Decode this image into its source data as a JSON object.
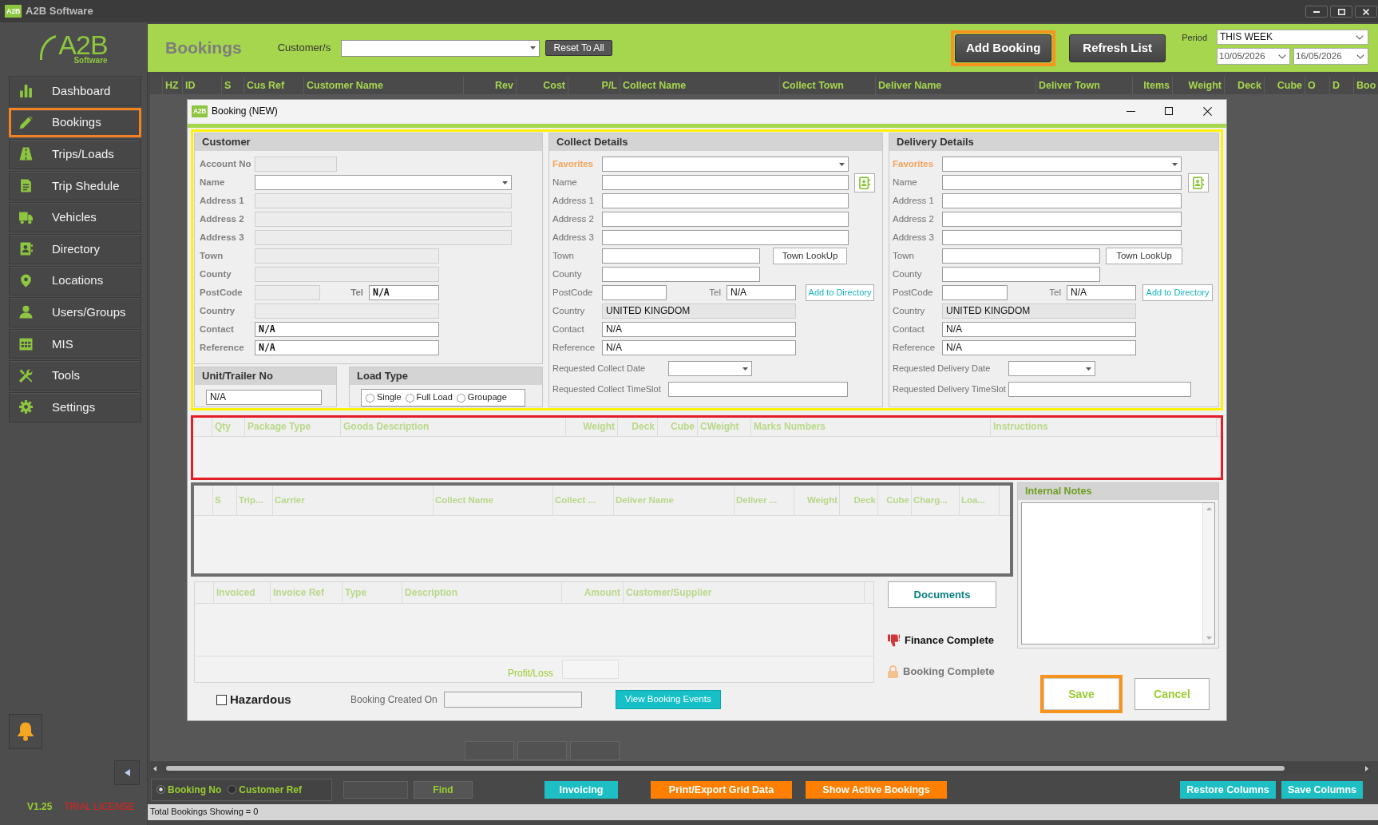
{
  "window": {
    "icon_text": "A2B",
    "title": "A2B Software"
  },
  "sidebar": {
    "logo": {
      "text": "A2B",
      "subtext": "Software"
    },
    "items": [
      {
        "label": "Dashboard",
        "selected": false
      },
      {
        "label": "Bookings",
        "selected": true
      },
      {
        "label": "Trips/Loads",
        "selected": false
      },
      {
        "label": "Trip Shedule",
        "selected": false
      },
      {
        "label": "Vehicles",
        "selected": false
      },
      {
        "label": "Directory",
        "selected": false
      },
      {
        "label": "Locations",
        "selected": false
      },
      {
        "label": "Users/Groups",
        "selected": false
      },
      {
        "label": "MIS",
        "selected": false
      },
      {
        "label": "Tools",
        "selected": false
      },
      {
        "label": "Settings",
        "selected": false
      }
    ],
    "version": "V1.25",
    "license": "TRIAL LICENSE"
  },
  "header": {
    "title": "Bookings",
    "customer_label": "Customer/s",
    "reset_button": "Reset To All",
    "add_button": {
      "label": "Add Booking",
      "highlighted": true
    },
    "refresh_button": "Refresh List",
    "period_label": "Period",
    "period": "THIS WEEK",
    "date_from": "10/05/2026",
    "date_to": "16/05/2026"
  },
  "grid": {
    "columns": [
      "HZ",
      "ID",
      "S",
      "Cus Ref",
      "Customer Name",
      "Rev",
      "Cost",
      "P/L",
      "Collect Name",
      "Collect Town",
      "Deliver Name",
      "Deliver Town",
      "Items",
      "Weight",
      "Deck",
      "Cube",
      "O",
      "D",
      "Boo"
    ]
  },
  "dialog": {
    "icon_text": "A2B",
    "title": "Booking (NEW)",
    "details_highlighted": true,
    "customer": {
      "title": "Customer",
      "rows": [
        {
          "label": "Account No",
          "kind": "text",
          "disabled": true
        },
        {
          "label": "Name",
          "kind": "dropdown",
          "disabled": false
        },
        {
          "label": "Address 1",
          "kind": "text",
          "disabled": true
        },
        {
          "label": "Address 2",
          "kind": "text",
          "disabled": true
        },
        {
          "label": "Address 3",
          "kind": "text",
          "disabled": true
        },
        {
          "label": "Town",
          "kind": "text",
          "disabled": true
        },
        {
          "label": "County",
          "kind": "text",
          "disabled": true
        },
        {
          "label": "PostCode",
          "kind": "text",
          "disabled": true,
          "tel": {
            "label": "Tel",
            "value": "N/A"
          }
        },
        {
          "label": "Country",
          "kind": "text",
          "disabled": true
        },
        {
          "label": "Contact",
          "kind": "text",
          "disabled": false,
          "value": "N/A"
        },
        {
          "label": "Reference",
          "kind": "text",
          "disabled": false,
          "value": "N/A"
        }
      ]
    },
    "unit": {
      "title": "Unit/Trailer No",
      "value": "N/A"
    },
    "load_type": {
      "title": "Load Type",
      "options": [
        {
          "label": "Single",
          "selected": false
        },
        {
          "label": "Full Load",
          "selected": false
        },
        {
          "label": "Groupage",
          "selected": false
        }
      ]
    },
    "collect": {
      "title": "Collect Details",
      "rows": [
        {
          "label": "Favorites",
          "kind": "favorites",
          "disabled": false
        },
        {
          "label": "Name",
          "kind": "text",
          "disabled": false,
          "contact_button": true
        },
        {
          "label": "Address 1",
          "kind": "text",
          "disabled": false
        },
        {
          "label": "Address 2",
          "kind": "text",
          "disabled": false
        },
        {
          "label": "Address 3",
          "kind": "text",
          "disabled": false
        },
        {
          "label": "Town",
          "kind": "text",
          "disabled": false,
          "button": {
            "label": "Town LookUp",
            "kind": "lookup"
          }
        },
        {
          "label": "County",
          "kind": "text",
          "disabled": false
        },
        {
          "label": "PostCode",
          "kind": "text",
          "disabled": false,
          "tel": {
            "label": "Tel",
            "value": "N/A"
          },
          "button": {
            "label": "Add to Directory",
            "kind": "directory"
          }
        },
        {
          "label": "Country",
          "kind": "text",
          "disabled": true,
          "value": "UNITED KINGDOM"
        },
        {
          "label": "Contact",
          "kind": "text",
          "disabled": false,
          "value": "N/A"
        },
        {
          "label": "Reference",
          "kind": "text",
          "disabled": false,
          "value": "N/A"
        }
      ],
      "schedule": [
        {
          "label": "Requested Collect Date",
          "kind": "dropdown"
        },
        {
          "label": "Requested Collect TimeSlot",
          "kind": "text"
        }
      ]
    },
    "delivery": {
      "title": "Delivery Details",
      "rows": [
        {
          "label": "Favorites",
          "kind": "favorites",
          "disabled": false
        },
        {
          "label": "Name",
          "kind": "text",
          "disabled": false,
          "contact_button": true
        },
        {
          "label": "Address 1",
          "kind": "text",
          "disabled": false
        },
        {
          "label": "Address 2",
          "kind": "text",
          "disabled": false
        },
        {
          "label": "Address 3",
          "kind": "text",
          "disabled": false
        },
        {
          "label": "Town",
          "kind": "text",
          "disabled": false,
          "button": {
            "label": "Town LookUp",
            "kind": "lookup"
          }
        },
        {
          "label": "County",
          "kind": "text",
          "disabled": false
        },
        {
          "label": "PostCode",
          "kind": "text",
          "disabled": false,
          "tel": {
            "label": "Tel",
            "value": "N/A"
          },
          "button": {
            "label": "Add to Directory",
            "kind": "directory"
          }
        },
        {
          "label": "Country",
          "kind": "text",
          "disabled": true,
          "value": "UNITED KINGDOM"
        },
        {
          "label": "Contact",
          "kind": "text",
          "disabled": false,
          "value": "N/A"
        },
        {
          "label": "Reference",
          "kind": "text",
          "disabled": false,
          "value": "N/A"
        }
      ],
      "schedule": [
        {
          "label": "Requested Delivery Date",
          "kind": "dropdown"
        },
        {
          "label": "Requested Delivery TimeSlot",
          "kind": "text"
        }
      ]
    },
    "goods_grid": {
      "highlighted": true,
      "columns": [
        "Qty",
        "Package Type",
        "Goods Description",
        "Weight",
        "Deck",
        "Cube",
        "CWeight",
        "Marks Numbers",
        "Instructions"
      ]
    },
    "trips_grid": {
      "highlighted": true,
      "columns": [
        "S",
        "Trip...",
        "Carrier",
        "Collect Name",
        "Collect ...",
        "Deliver Name",
        "Deliver ...",
        "Weight",
        "Deck",
        "Cube",
        "Charg...",
        "Loa..."
      ]
    },
    "internal_notes": {
      "title": "Internal Notes"
    },
    "invoice_grid": {
      "columns": [
        "Invoiced",
        "Invoice Ref",
        "Type",
        "Description",
        "Amount",
        "Customer/Supplier"
      ],
      "profit_label": "Profit/Loss"
    },
    "documents_button": "Documents",
    "statuses": [
      {
        "kind": "finance",
        "label": "Finance Complete"
      },
      {
        "kind": "booking",
        "label": "Booking Complete"
      }
    ],
    "hazardous": {
      "label": "Hazardous",
      "checked": false
    },
    "created_label": "Booking Created On",
    "events_button": "View Booking Events",
    "save_button": {
      "label": "Save",
      "highlighted": true
    },
    "cancel_button": "Cancel"
  },
  "toolbar": {
    "search_by": [
      {
        "label": "Booking No",
        "selected": true
      },
      {
        "label": "Customer Ref",
        "selected": false
      }
    ],
    "find_button": "Find",
    "buttons": [
      {
        "label": "Invoicing",
        "color": "#1dbfc4"
      },
      {
        "label": "Print/Export Grid Data",
        "color": "#ff8000"
      },
      {
        "label": "Show Active Bookings",
        "color": "#ff8000"
      },
      {
        "label": "Restore Columns",
        "color": "#1dbfc4"
      },
      {
        "label": "Save Columns",
        "color": "#1dbfc4"
      }
    ]
  },
  "status_bar": "Total Bookings Showing = 0"
}
